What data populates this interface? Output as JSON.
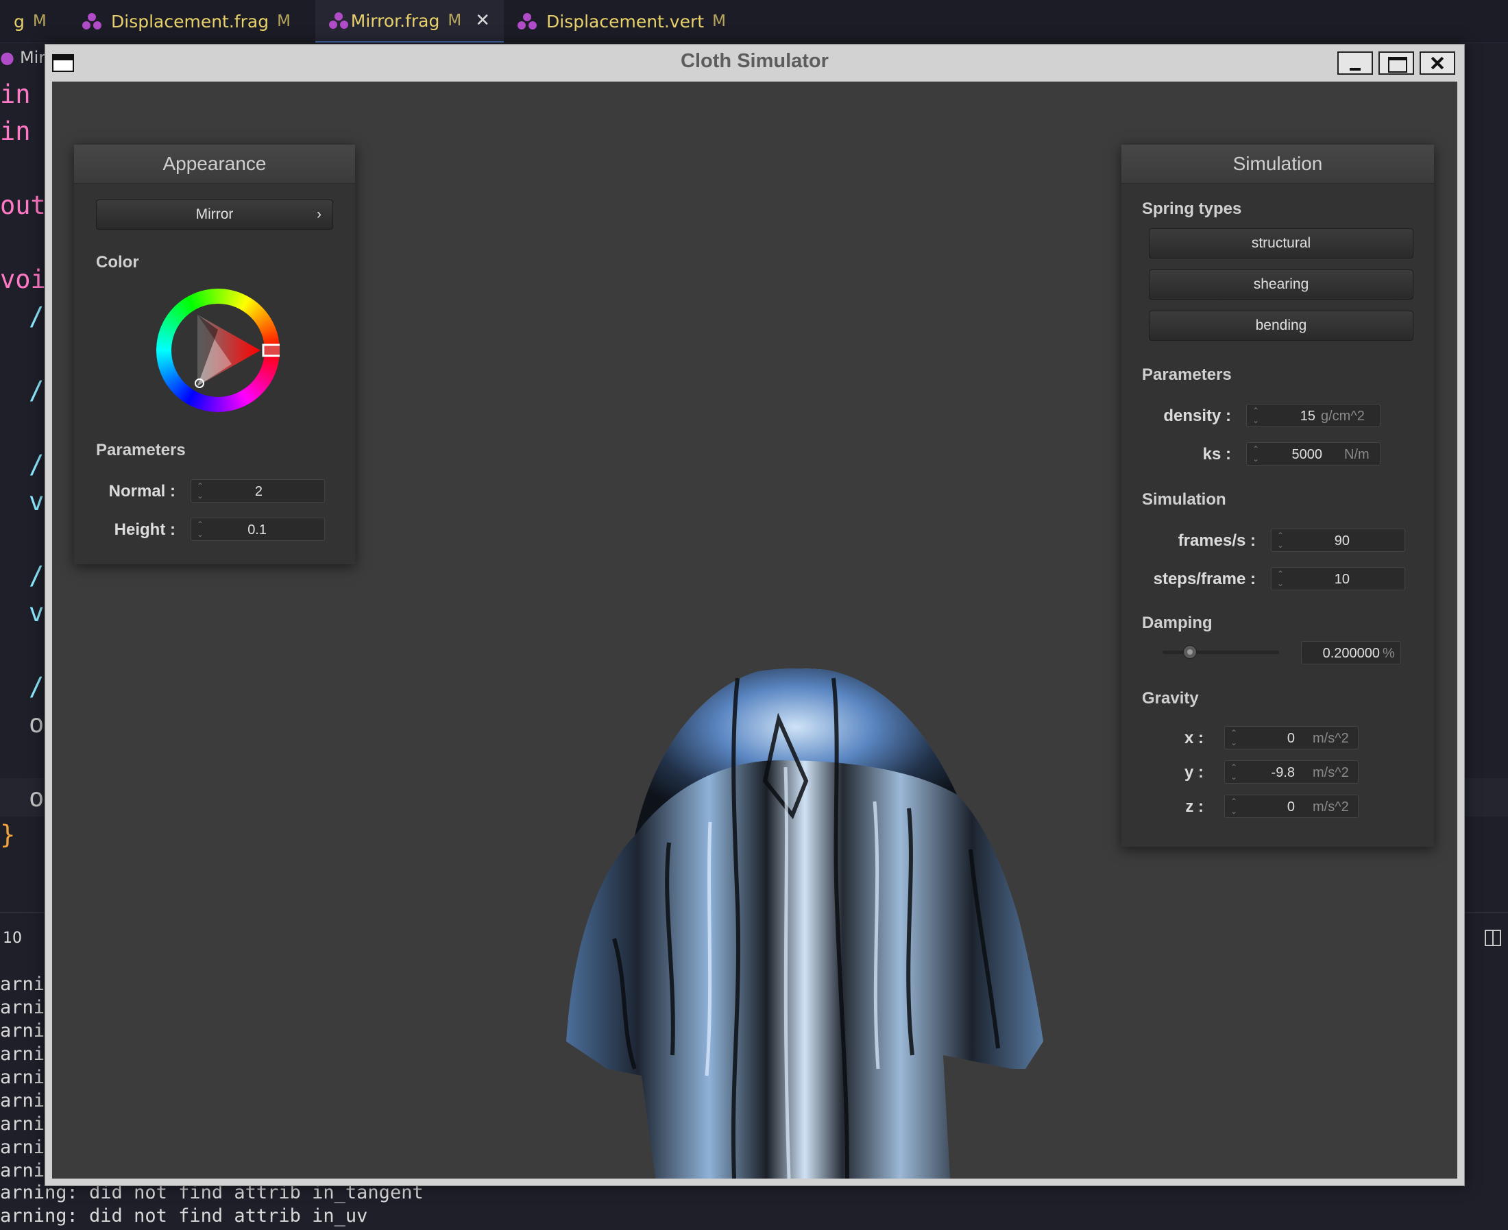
{
  "editor": {
    "tabs": [
      {
        "label": "g",
        "mod": "M"
      },
      {
        "label": "Displacement.frag",
        "mod": "M"
      },
      {
        "label": "Mirror.frag",
        "mod": "M",
        "close": "✕"
      },
      {
        "label": "Displacement.vert",
        "mod": "M"
      }
    ],
    "breadcrumb": "Mir",
    "code_lines": [
      "in",
      "in",
      "out",
      "voi",
      "/",
      "/",
      "/",
      "v",
      "/",
      "v",
      "/",
      "o",
      "o",
      "}"
    ],
    "terminal_tab": "10",
    "terminal_lines": [
      "arni",
      "arni",
      "arni",
      "arni",
      "arni",
      "arni",
      "arni",
      "arni",
      "arni",
      "arning: did not find attrib in_tangent",
      "arning: did not find attrib in_uv"
    ]
  },
  "window": {
    "title": "Cloth Simulator"
  },
  "appearance": {
    "title": "Appearance",
    "material": "Mirror",
    "material_arrow": "›",
    "color_label": "Color",
    "params_label": "Parameters",
    "normal_label": "Normal :",
    "normal_value": "2",
    "height_label": "Height :",
    "height_value": "0.1",
    "selected_hue": "#ff0000"
  },
  "simulation": {
    "title": "Simulation",
    "spring_types_label": "Spring types",
    "springs": [
      "structural",
      "shearing",
      "bending"
    ],
    "params_label": "Parameters",
    "density_label": "density :",
    "density_value": "15",
    "density_unit": "g/cm^2",
    "ks_label": "ks :",
    "ks_value": "5000",
    "ks_unit": "N/m",
    "sim_label": "Simulation",
    "fps_label": "frames/s :",
    "fps_value": "90",
    "steps_label": "steps/frame :",
    "steps_value": "10",
    "damping_label": "Damping",
    "damping_value": "0.200000",
    "damping_unit": "%",
    "damping_level": 0.2,
    "gravity_label": "Gravity",
    "gx_label": "x :",
    "gx_value": "0",
    "gy_label": "y :",
    "gy_value": "-9.8",
    "gz_label": "z :",
    "gz_value": "0",
    "g_unit": "m/s^2"
  }
}
